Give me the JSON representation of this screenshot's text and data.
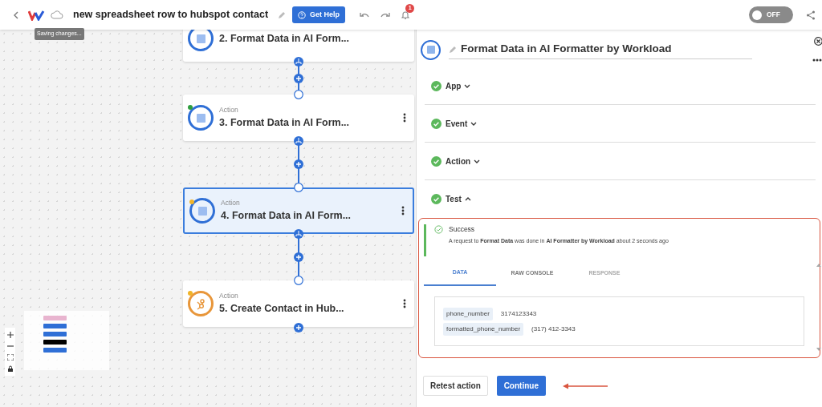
{
  "header": {
    "title": "new spreadsheet row to hubspot contact",
    "saving_tooltip": "Saving changes...",
    "help_button": "Get Help",
    "notification_count": "1",
    "toggle": {
      "on": false,
      "label": "OFF"
    }
  },
  "canvas": {
    "nodes": [
      {
        "kind": "ai",
        "title": "2. Format Data in AI Form...",
        "selected": false
      },
      {
        "kind": "ai",
        "label": "Action",
        "title": "3. Format Data in AI Form...",
        "selected": false,
        "color": "#2e9e3e"
      },
      {
        "kind": "ai",
        "label": "Action",
        "title": "4. Format Data in AI Form...",
        "selected": true,
        "color": "#f0b429"
      },
      {
        "kind": "hubspot",
        "label": "Action",
        "title": "5. Create Contact in Hub...",
        "selected": false,
        "color": "#f0b429"
      }
    ],
    "minimap_bars": [
      {
        "color": "#e8b4cf"
      },
      {
        "color": "#2f6fd6"
      },
      {
        "color": "#2f6fd6"
      },
      {
        "color": "#000000"
      },
      {
        "color": "#2f6fd6"
      }
    ]
  },
  "panel": {
    "title": "Format Data in AI Formatter by Workload",
    "sections": [
      {
        "label": "App",
        "done": true,
        "expanded": false
      },
      {
        "label": "Event",
        "done": true,
        "expanded": false
      },
      {
        "label": "Action",
        "done": true,
        "expanded": false
      },
      {
        "label": "Test",
        "done": true,
        "expanded": true
      }
    ],
    "result": {
      "status": "Success",
      "message": "A request to **Format Data** was done in **AI Formatter by Workload** about 2 seconds ago",
      "tabs": [
        {
          "label": "DATA",
          "selected": true,
          "disabled": false
        },
        {
          "label": "RAW CONSOLE",
          "selected": false,
          "disabled": false
        },
        {
          "label": "RESPONSE",
          "selected": false,
          "disabled": true
        }
      ],
      "fields": [
        {
          "key": "phone_number",
          "value": "3174123343"
        },
        {
          "key": "formatted_phone_number",
          "value": "(317) 412-3343"
        }
      ]
    },
    "buttons": [
      {
        "label": "Retest action",
        "kind": "secondary"
      },
      {
        "label": "Continue",
        "kind": "primary"
      }
    ]
  }
}
